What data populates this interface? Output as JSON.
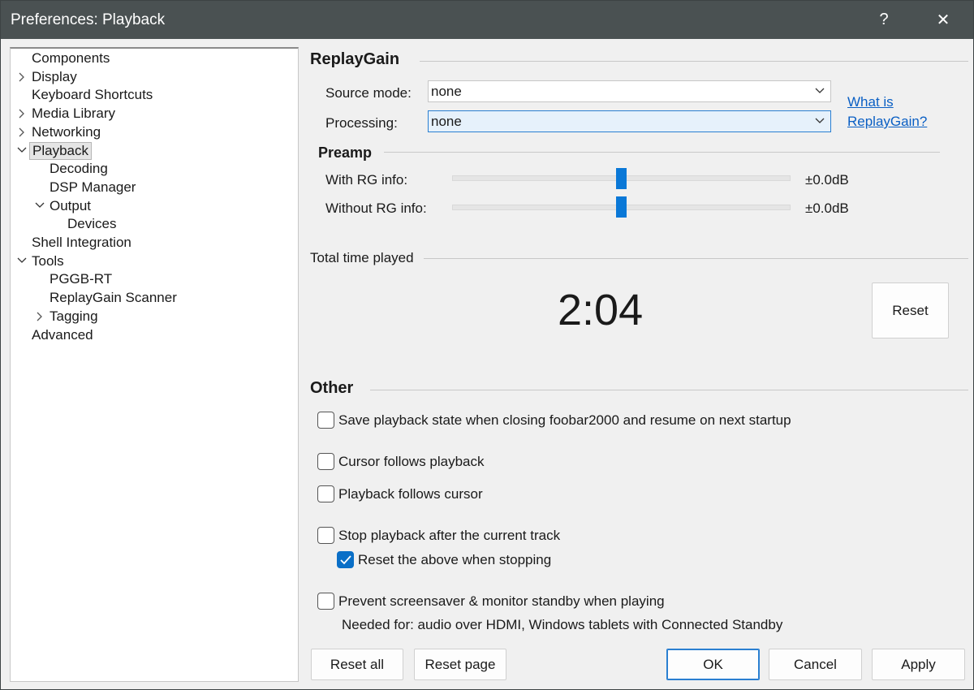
{
  "window": {
    "title": "Preferences: Playback",
    "help_glyph": "?",
    "close_glyph": "✕"
  },
  "tree": {
    "items": [
      {
        "label": "Components",
        "arrow": "none",
        "selected": false
      },
      {
        "label": "Display",
        "arrow": "collapsed",
        "selected": false
      },
      {
        "label": "Keyboard Shortcuts",
        "arrow": "none",
        "selected": false
      },
      {
        "label": "Media Library",
        "arrow": "collapsed",
        "selected": false
      },
      {
        "label": "Networking",
        "arrow": "collapsed",
        "selected": false
      },
      {
        "label": "Playback",
        "arrow": "expanded",
        "selected": true
      },
      {
        "label": "Decoding",
        "arrow": "none",
        "selected": false
      },
      {
        "label": "DSP Manager",
        "arrow": "none",
        "selected": false
      },
      {
        "label": "Output",
        "arrow": "expanded",
        "selected": false
      },
      {
        "label": "Devices",
        "arrow": "none",
        "selected": false
      },
      {
        "label": "Shell Integration",
        "arrow": "none",
        "selected": false
      },
      {
        "label": "Tools",
        "arrow": "expanded",
        "selected": false
      },
      {
        "label": "PGGB-RT",
        "arrow": "none",
        "selected": false
      },
      {
        "label": "ReplayGain Scanner",
        "arrow": "none",
        "selected": false
      },
      {
        "label": "Tagging",
        "arrow": "collapsed",
        "selected": false
      },
      {
        "label": "Advanced",
        "arrow": "none",
        "selected": false
      }
    ]
  },
  "replaygain": {
    "title": "ReplayGain",
    "source_mode_label": "Source mode:",
    "source_mode_value": "none",
    "processing_label": "Processing:",
    "processing_value": "none",
    "link_line1": "What is",
    "link_line2": "ReplayGain?"
  },
  "preamp": {
    "title": "Preamp",
    "with_label": "With RG info:",
    "with_value": "±0.0dB",
    "with_level": 0.5,
    "without_label": "Without RG info:",
    "without_value": "±0.0dB",
    "without_level": 0.5
  },
  "total_time": {
    "title": "Total time played",
    "value": "2:04",
    "reset_label": "Reset"
  },
  "other": {
    "title": "Other",
    "save_state": {
      "label": "Save playback state when closing foobar2000 and resume on next startup",
      "checked": false
    },
    "cursor_follows": {
      "label": "Cursor follows playback",
      "checked": false
    },
    "playback_follows": {
      "label": "Playback follows cursor",
      "checked": false
    },
    "stop_after": {
      "label": "Stop playback after the current track",
      "checked": false
    },
    "reset_above": {
      "label": "Reset the above when stopping",
      "checked": true
    },
    "prevent_screensaver": {
      "label": "Prevent screensaver & monitor standby when playing",
      "checked": false
    },
    "needed_for_note": "Needed for: audio over HDMI, Windows tablets with Connected Standby"
  },
  "buttons": {
    "reset_all": "Reset all",
    "reset_page": "Reset page",
    "ok": "OK",
    "cancel": "Cancel",
    "apply": "Apply"
  },
  "colors": {
    "accent": "#0a78d7",
    "titlebar": "#4a5152",
    "link": "#0a5fc4"
  }
}
